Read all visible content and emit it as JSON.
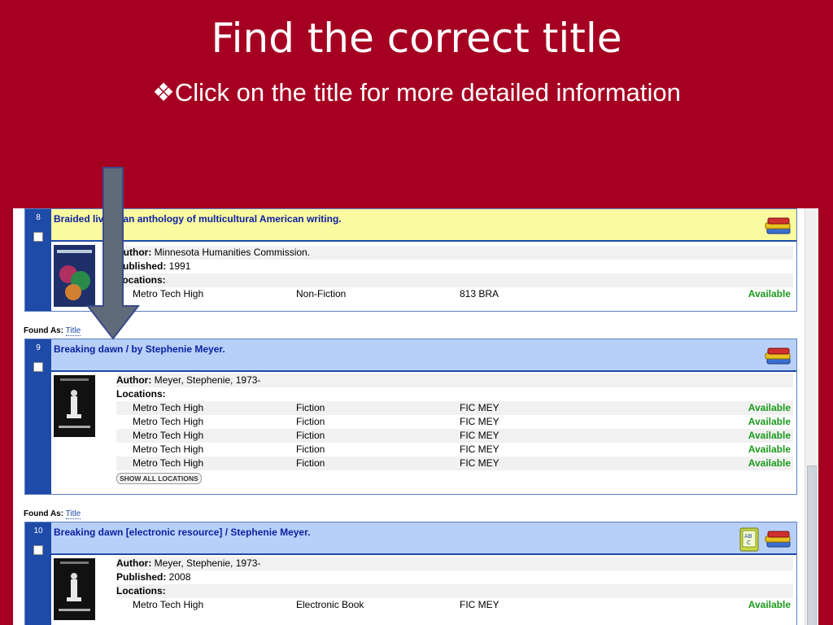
{
  "slide": {
    "title": "Find the correct title",
    "bullet": "❖Click on the title for more detailed information"
  },
  "results": [
    {
      "number": "8",
      "title": "Braided lives : an anthology of multicultural American writing.",
      "cover_color": "#2a3a7a",
      "fields": [
        {
          "label": "Author:",
          "value": " Minnesota Humanities Commission."
        },
        {
          "label": "Published:",
          "value": " 1991"
        },
        {
          "label": "Locations:",
          "value": ""
        }
      ],
      "locations": [
        {
          "library": "Metro Tech High",
          "collection": "Non-Fiction",
          "call_number": "813 BRA",
          "status": "Available"
        }
      ],
      "icons": [
        "book-stack-icon"
      ]
    },
    {
      "number": "9",
      "found_label": "Found As:",
      "found_value": "Title",
      "title": "Breaking dawn / by Stephenie Meyer.",
      "cover_color": "#111111",
      "fields": [
        {
          "label": "Author:",
          "value": " Meyer, Stephenie, 1973-"
        },
        {
          "label": "Locations:",
          "value": ""
        }
      ],
      "locations": [
        {
          "library": "Metro Tech High",
          "collection": "Fiction",
          "call_number": "FIC MEY",
          "status": "Available"
        },
        {
          "library": "Metro Tech High",
          "collection": "Fiction",
          "call_number": "FIC MEY",
          "status": "Available"
        },
        {
          "library": "Metro Tech High",
          "collection": "Fiction",
          "call_number": "FIC MEY",
          "status": "Available"
        },
        {
          "library": "Metro Tech High",
          "collection": "Fiction",
          "call_number": "FIC MEY",
          "status": "Available"
        },
        {
          "library": "Metro Tech High",
          "collection": "Fiction",
          "call_number": "FIC MEY",
          "status": "Available"
        }
      ],
      "show_all": "SHOW ALL LOCATIONS",
      "icons": [
        "book-stack-icon"
      ]
    },
    {
      "number": "10",
      "found_label": "Found As:",
      "found_value": "Title",
      "title": "Breaking dawn [electronic resource] / Stephenie Meyer.",
      "cover_color": "#111111",
      "fields": [
        {
          "label": "Author:",
          "value": " Meyer, Stephenie, 1973-"
        },
        {
          "label": "Published:",
          "value": " 2008"
        },
        {
          "label": "Locations:",
          "value": ""
        }
      ],
      "locations": [
        {
          "library": "Metro Tech High",
          "collection": "Electronic Book",
          "call_number": "FIC MEY",
          "status": "Available"
        }
      ],
      "icons": [
        "ebook-icon",
        "book-stack-icon"
      ]
    }
  ],
  "colors": {
    "slide_background": "#a50021",
    "record_header_8": "#fafaa0",
    "record_header_9": "#b8d0f8",
    "record_header_10": "#b8d0f8",
    "number_column": "#1e4aa8",
    "available": "#1a9a1a",
    "arrow": "#5f6b78"
  },
  "arrow_icon": "down-arrow-icon"
}
